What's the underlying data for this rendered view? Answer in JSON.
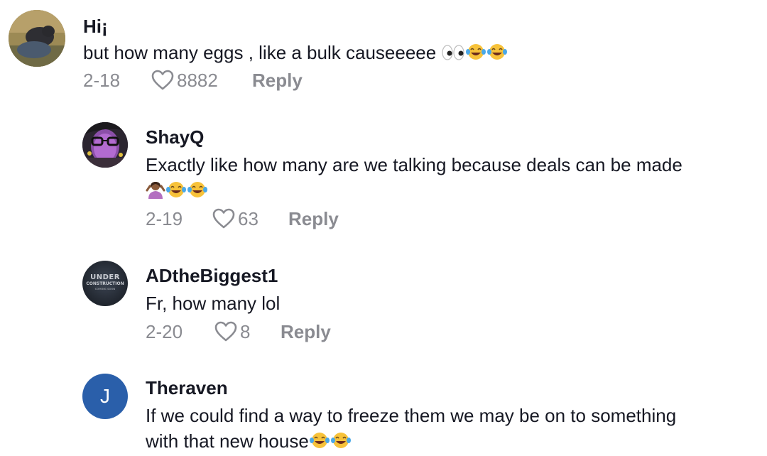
{
  "comments": [
    {
      "username": "Hi¡",
      "text": "but how many eggs , like a bulk causeeeee",
      "emojis": [
        "eyes-emoji",
        "tears-of-joy-emoji",
        "tears-of-joy-emoji"
      ],
      "date": "2-18",
      "likes": "8882",
      "reply_label": "Reply"
    },
    {
      "username": "ShayQ",
      "text": "Exactly like how many are we talking because deals can be made",
      "emojis": [
        "shrug-emoji",
        "tears-of-joy-emoji",
        "tears-of-joy-emoji"
      ],
      "date": "2-19",
      "likes": "63",
      "reply_label": "Reply"
    },
    {
      "username": "ADtheBiggest1",
      "avatar_text": [
        "UNDER",
        "CONSTRUCTION",
        "COMING SOON"
      ],
      "text": "Fr, how many lol",
      "date": "2-20",
      "likes": "8",
      "reply_label": "Reply"
    },
    {
      "username": "Theraven",
      "avatar_initial": "J",
      "text_line1": "If we could find a way to freeze them we may be on to something",
      "text_line2": "with that new house",
      "emojis": [
        "tears-of-joy-emoji",
        "tears-of-joy-emoji"
      ]
    }
  ],
  "colors": {
    "text_primary": "#161823",
    "text_secondary": "#8a8b91",
    "avatar_blue": "#2a5faa"
  }
}
